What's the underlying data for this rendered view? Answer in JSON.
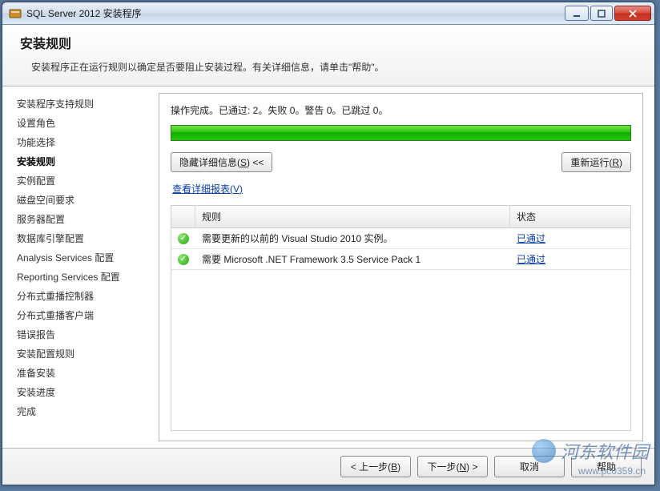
{
  "window": {
    "title": "SQL Server 2012 安装程序"
  },
  "header": {
    "title": "安装规则",
    "subtitle": "安装程序正在运行规则以确定是否要阻止安装过程。有关详细信息，请单击\"帮助\"。"
  },
  "sidebar": {
    "items": [
      {
        "label": "安装程序支持规则",
        "current": false
      },
      {
        "label": "设置角色",
        "current": false
      },
      {
        "label": "功能选择",
        "current": false
      },
      {
        "label": "安装规则",
        "current": true
      },
      {
        "label": "实例配置",
        "current": false
      },
      {
        "label": "磁盘空间要求",
        "current": false
      },
      {
        "label": "服务器配置",
        "current": false
      },
      {
        "label": "数据库引擎配置",
        "current": false
      },
      {
        "label": "Analysis Services 配置",
        "current": false
      },
      {
        "label": "Reporting Services 配置",
        "current": false
      },
      {
        "label": "分布式重播控制器",
        "current": false
      },
      {
        "label": "分布式重播客户端",
        "current": false
      },
      {
        "label": "错误报告",
        "current": false
      },
      {
        "label": "安装配置规则",
        "current": false
      },
      {
        "label": "准备安装",
        "current": false
      },
      {
        "label": "安装进度",
        "current": false
      },
      {
        "label": "完成",
        "current": false
      }
    ]
  },
  "main": {
    "status_prefix": "操作完成。已通过: ",
    "passed": "2",
    "status_mid1": "。失败 ",
    "failed": "0",
    "status_mid2": "。警告 ",
    "warn": "0",
    "status_mid3": "。已跳过 ",
    "skipped": "0",
    "status_suffix": "。",
    "hide_details_pre": "隐藏详细信息(",
    "hide_details_key": "S",
    "hide_details_post": ") <<",
    "rerun_pre": "重新运行(",
    "rerun_key": "R",
    "rerun_post": ")",
    "view_report_pre": "查看详细报表(",
    "view_report_key": "V",
    "view_report_post": ")",
    "col_rule": "规则",
    "col_state": "状态",
    "rules": [
      {
        "name": "需要更新的以前的 Visual Studio 2010 实例。",
        "status": "已通过"
      },
      {
        "name": "需要 Microsoft .NET Framework 3.5 Service Pack 1",
        "status": "已通过"
      }
    ]
  },
  "footer": {
    "back_pre": "< 上一步(",
    "back_key": "B",
    "back_post": ")",
    "next_pre": "下一步(",
    "next_key": "N",
    "next_post": ") >",
    "cancel": "取消",
    "help": "帮助"
  },
  "watermark": {
    "text": "河东软件园",
    "url": "www.pc0359.cn"
  }
}
